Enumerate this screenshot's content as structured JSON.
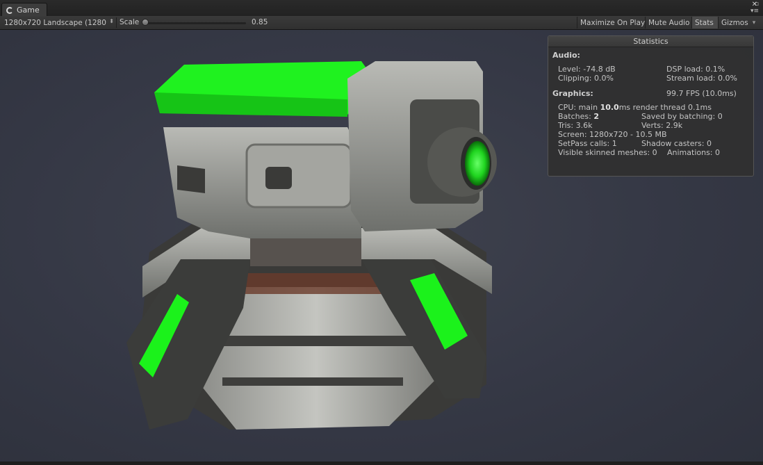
{
  "window": {
    "tab_label": "Game",
    "maximize_glyph": "▫",
    "close_glyph": "✕",
    "menu_glyph": "▾≡"
  },
  "toolbar": {
    "resolution": "1280x720 Landscape (1280",
    "resolution_arrow": "⬍",
    "scale_label": "Scale",
    "scale_value": "0.85",
    "maximize_on_play": "Maximize On Play",
    "mute_audio": "Mute Audio",
    "stats": "Stats",
    "gizmos": "Gizmos",
    "gizmos_arrow": "▾"
  },
  "statistics": {
    "title": "Statistics",
    "audio_header": "Audio:",
    "level": "Level: -74.8 dB",
    "dsp_load": "DSP load: 0.1%",
    "clipping": "Clipping: 0.0%",
    "stream_load": "Stream load: 0.0%",
    "graphics_header": "Graphics:",
    "fps": "99.7 FPS (10.0ms)",
    "cpu_prefix": "CPU: main ",
    "cpu_main": "10.0",
    "cpu_suffix": "ms  render thread 0.1ms",
    "batches_prefix": "Batches: ",
    "batches": "2",
    "saved_by_batching": "Saved by batching: 0",
    "tris": "Tris: 3.6k",
    "verts": "Verts: 2.9k",
    "screen": "Screen: 1280x720 - 10.5 MB",
    "setpass": "SetPass calls: 1",
    "shadow_casters": "Shadow casters: 0",
    "visible_skinned": "Visible skinned meshes: 0",
    "animations": "Animations: 0"
  },
  "scene": {
    "object": "turret-model",
    "accent_color": "#22ff22",
    "background_color": "#383b47"
  }
}
